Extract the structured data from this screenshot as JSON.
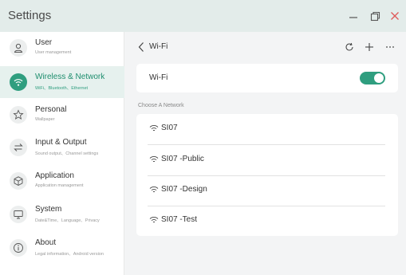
{
  "window": {
    "title": "Settings"
  },
  "titlebar_controls": {
    "minimize": "minimize-icon",
    "restore": "restore-icon",
    "close": "close-icon",
    "close_color": "#e05a5a"
  },
  "colors": {
    "accent": "#2f9e7f",
    "active_bg": "#e6f1ee",
    "titlebar_bg": "#e3ecea"
  },
  "sidebar": {
    "items": [
      {
        "label": "User",
        "sub": "User management",
        "icon": "user-icon"
      },
      {
        "label": "Wireless & Network",
        "sub": "WiFi、Bluetooth、Ethernet",
        "icon": "wifi-icon",
        "active": true
      },
      {
        "label": "Personal",
        "sub": "Wallpaper",
        "icon": "star-icon"
      },
      {
        "label": "Input & Output",
        "sub": "Sound output、Channel settings",
        "icon": "swap-arrows-icon"
      },
      {
        "label": "Application",
        "sub": "Application management",
        "icon": "cube-icon"
      },
      {
        "label": "System",
        "sub": "Date&Time、Language、Privacy",
        "icon": "monitor-icon"
      },
      {
        "label": "About",
        "sub": "Legal information、Android version",
        "icon": "info-icon"
      }
    ]
  },
  "main": {
    "header": {
      "back_icon": "chevron-left-icon",
      "title": "Wi-Fi",
      "icons": [
        "refresh-icon",
        "plus-icon",
        "more-icon"
      ]
    },
    "wifi_toggle": {
      "label": "Wi-Fi",
      "enabled": true
    },
    "section_label": "Choose A Network",
    "networks": [
      {
        "name": "SI07",
        "icon": "wifi-signal-icon"
      },
      {
        "name": "SI07 -Public",
        "icon": "wifi-signal-icon"
      },
      {
        "name": "SI07 -Design",
        "icon": "wifi-signal-icon"
      },
      {
        "name": "SI07 -Test",
        "icon": "wifi-signal-icon"
      }
    ]
  }
}
